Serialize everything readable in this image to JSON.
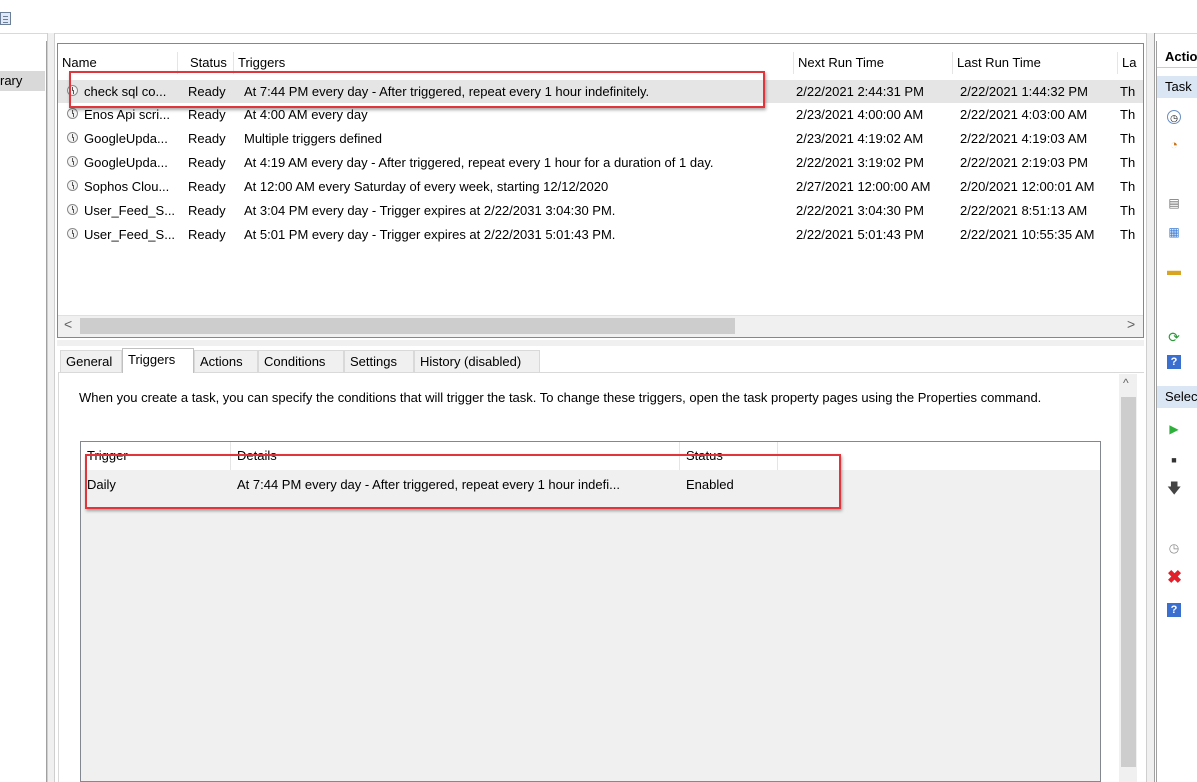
{
  "left_pane": {
    "selected_fragment": "rary"
  },
  "task_list": {
    "columns": [
      "Name",
      "Status",
      "Triggers",
      "Next Run Time",
      "Last Run Time",
      "La"
    ],
    "rows": [
      {
        "name": "check sql co...",
        "status": "Ready",
        "triggers": "At 7:44 PM every day - After triggered, repeat every 1 hour indefinitely.",
        "next": "2/22/2021 2:44:31 PM",
        "last": "2/22/2021 1:44:32 PM",
        "extra": "Th"
      },
      {
        "name": "Enos Api scri...",
        "status": "Ready",
        "triggers": "At 4:00 AM every day",
        "next": "2/23/2021 4:00:00 AM",
        "last": "2/22/2021 4:03:00 AM",
        "extra": "Th"
      },
      {
        "name": "GoogleUpda...",
        "status": "Ready",
        "triggers": "Multiple triggers defined",
        "next": "2/23/2021 4:19:02 AM",
        "last": "2/22/2021 4:19:03 AM",
        "extra": "Th"
      },
      {
        "name": "GoogleUpda...",
        "status": "Ready",
        "triggers": "At 4:19 AM every day - After triggered, repeat every 1 hour for a duration of 1 day.",
        "next": "2/22/2021 3:19:02 PM",
        "last": "2/22/2021 2:19:03 PM",
        "extra": "Th"
      },
      {
        "name": "Sophos Clou...",
        "status": "Ready",
        "triggers": "At 12:00 AM every Saturday of every week, starting 12/12/2020",
        "next": "2/27/2021 12:00:00 AM",
        "last": "2/20/2021 12:00:01 AM",
        "extra": "Th"
      },
      {
        "name": "User_Feed_S...",
        "status": "Ready",
        "triggers": "At 3:04 PM every day - Trigger expires at 2/22/2031 3:04:30 PM.",
        "next": "2/22/2021 3:04:30 PM",
        "last": "2/22/2021 8:51:13 AM",
        "extra": "Th"
      },
      {
        "name": "User_Feed_S...",
        "status": "Ready",
        "triggers": "At 5:01 PM every day - Trigger expires at 2/22/2031 5:01:43 PM.",
        "next": "2/22/2021 5:01:43 PM",
        "last": "2/22/2021 10:55:35 AM",
        "extra": "Th"
      }
    ],
    "scroll_left": "<",
    "scroll_right": ">"
  },
  "tabs": [
    "General",
    "Triggers",
    "Actions",
    "Conditions",
    "Settings",
    "History (disabled)"
  ],
  "active_tab": "Triggers",
  "triggers_tab": {
    "description": "When you create a task, you can specify the conditions that will trigger the task.  To change these triggers, open the task property pages using the Properties command.",
    "columns": [
      "Trigger",
      "Details",
      "Status"
    ],
    "rows": [
      {
        "trigger": "Daily",
        "details": "At 7:44 PM every day - After triggered, repeat every 1 hour indefi...",
        "status": "Enabled"
      }
    ],
    "scroll_up": "^"
  },
  "actions_pane": {
    "title_fragment": "Actio",
    "section1_fragment": "Task",
    "section2_fragment": "Selec"
  },
  "colors": {
    "highlight": "#e0353a",
    "selection": "#e5e5e5",
    "section": "#dbe6f4"
  }
}
